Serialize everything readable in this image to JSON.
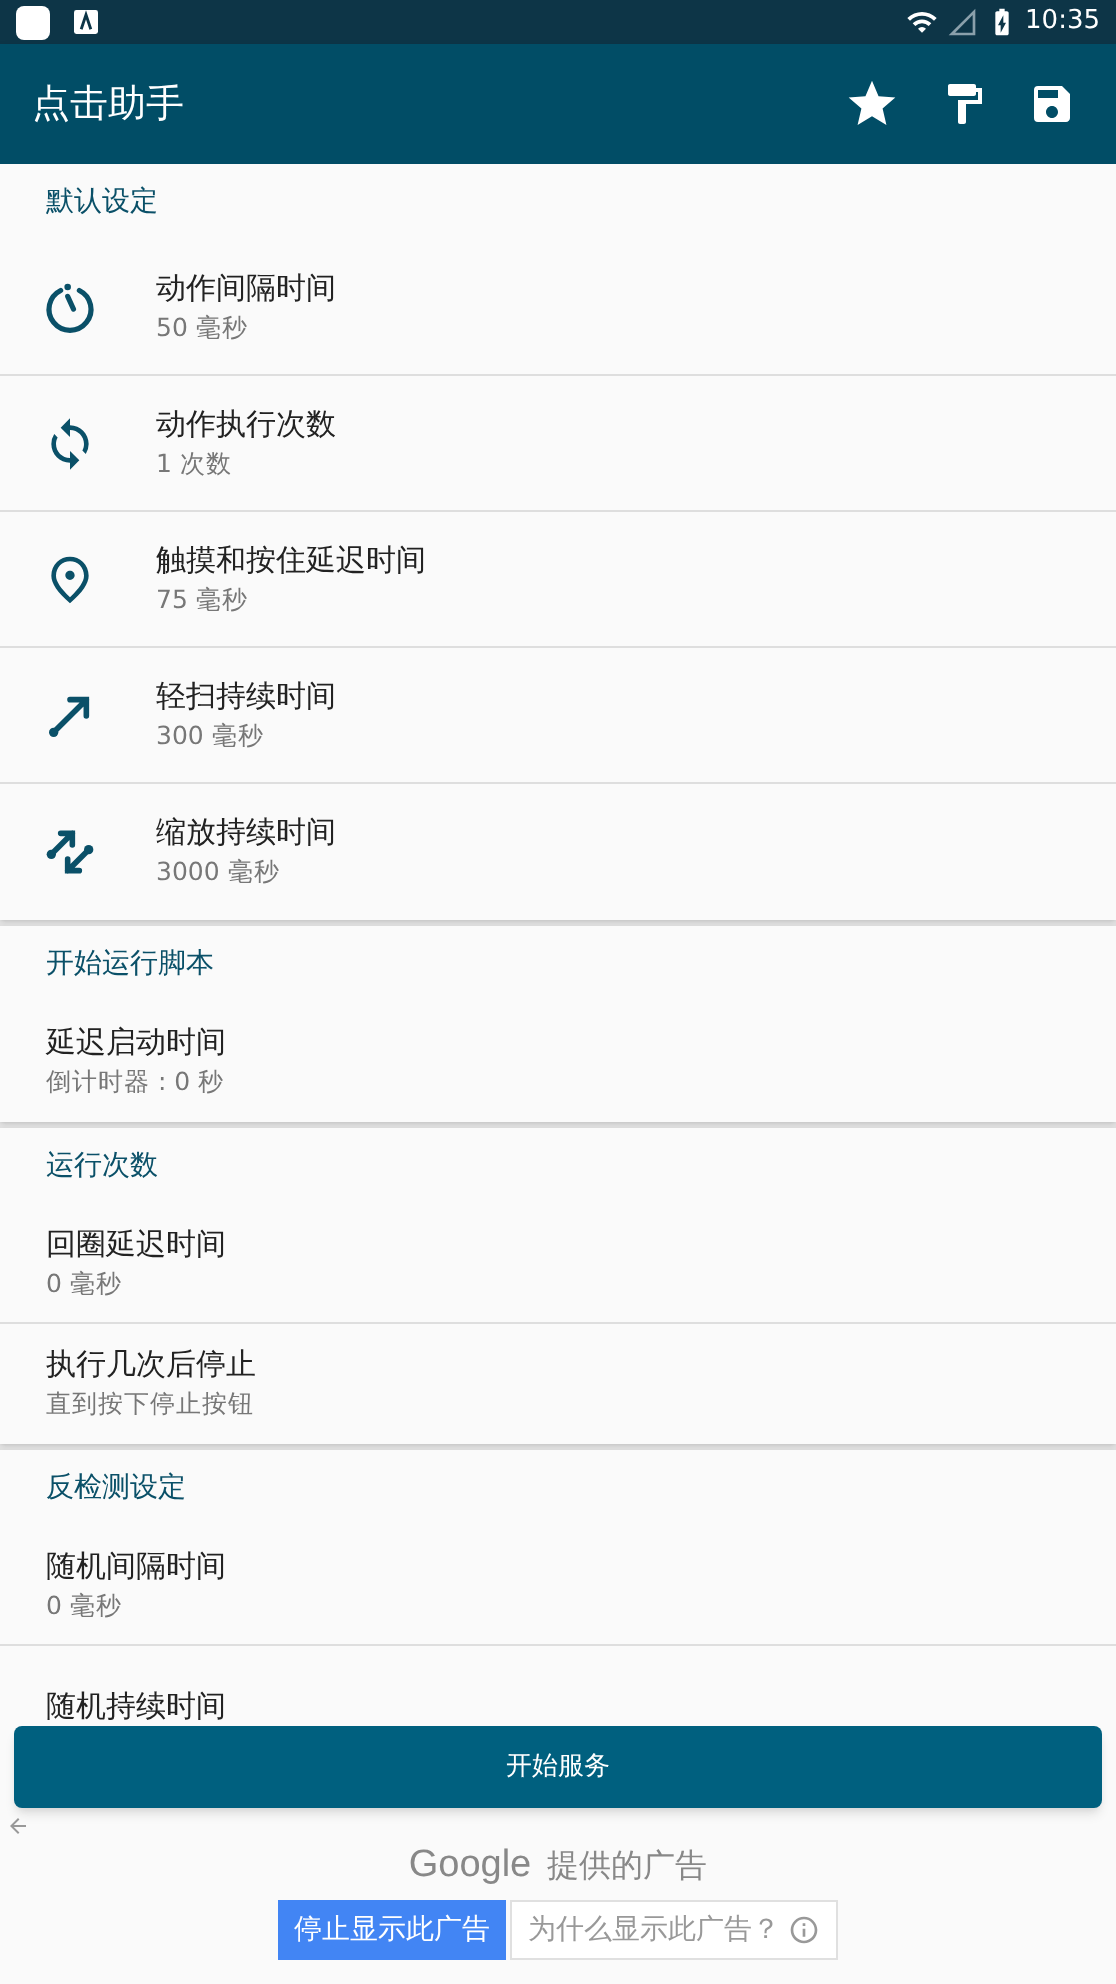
{
  "status_bar": {
    "time": "10:35"
  },
  "app_bar": {
    "title": "点击助手"
  },
  "sections": [
    {
      "title": "默认设定",
      "items": [
        {
          "kind": "timer",
          "title": "动作间隔时间",
          "subtitle": "50 毫秒"
        },
        {
          "kind": "repeat",
          "title": "动作执行次数",
          "subtitle": "1 次数"
        },
        {
          "kind": "pin",
          "title": "触摸和按住延迟时间",
          "subtitle": "75 毫秒"
        },
        {
          "kind": "swipe",
          "title": "轻扫持续时间",
          "subtitle": "300 毫秒"
        },
        {
          "kind": "pinch",
          "title": "缩放持续时间",
          "subtitle": "3000 毫秒"
        }
      ]
    },
    {
      "title": "开始运行脚本",
      "items": [
        {
          "title": "延迟启动时间",
          "subtitle": "倒计时器 : 0 秒"
        }
      ]
    },
    {
      "title": "运行次数",
      "items": [
        {
          "title": "回圈延迟时间",
          "subtitle": "0 毫秒"
        },
        {
          "title": "执行几次后停止",
          "subtitle": "直到按下停止按钮"
        }
      ]
    },
    {
      "title": "反检测设定",
      "items": [
        {
          "title": "随机间隔时间",
          "subtitle": "0 毫秒"
        },
        {
          "title": "随机持续时间"
        }
      ]
    }
  ],
  "start_button": "开始服务",
  "ad": {
    "brand": "Google",
    "label": "提供的广告",
    "stop_button": "停止显示此广告",
    "why_button": "为什么显示此广告？"
  }
}
